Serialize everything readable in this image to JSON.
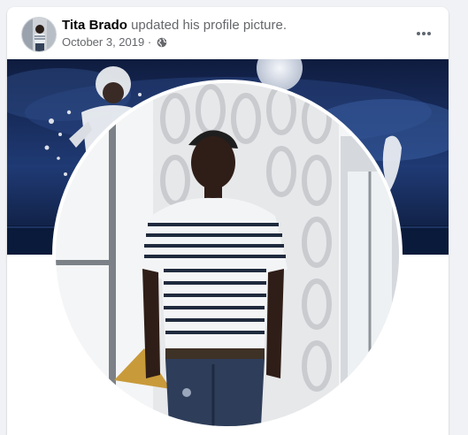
{
  "post": {
    "author_name": "Tita Brado",
    "action": "updated his profile picture.",
    "date": "October 3, 2019",
    "separator": "·",
    "privacy_icon": "globe-icon",
    "menu_icon": "more-options-icon"
  },
  "colors": {
    "page_bg": "#f0f2f5",
    "card_bg": "#ffffff",
    "primary_text": "#050505",
    "secondary_text": "#65676b",
    "cover_sky": "#1a2c5a"
  }
}
